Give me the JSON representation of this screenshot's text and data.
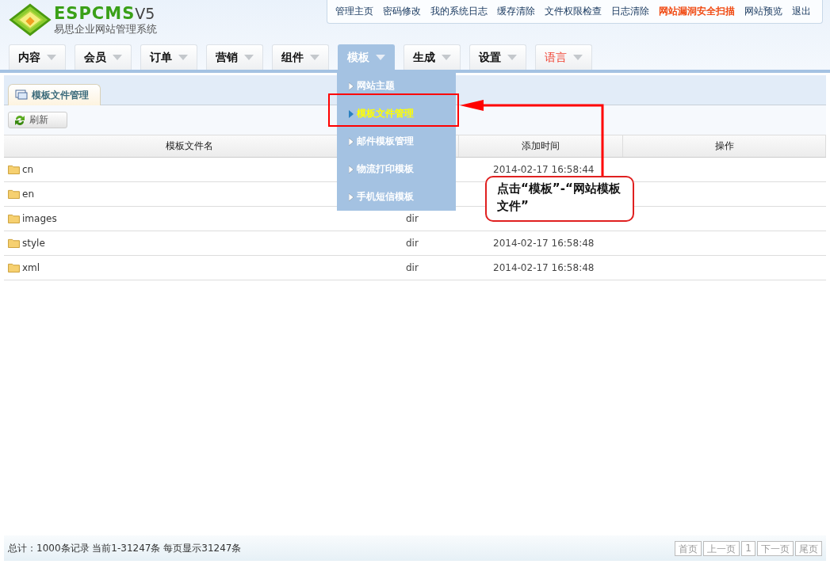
{
  "logo": {
    "brand": "ESPCMS",
    "version": "V5",
    "subtitle": "易思企业网站管理系统"
  },
  "top_links": [
    {
      "label": "管理主页",
      "alert": false
    },
    {
      "label": "密码修改",
      "alert": false
    },
    {
      "label": "我的系统日志",
      "alert": false
    },
    {
      "label": "缓存清除",
      "alert": false
    },
    {
      "label": "文件权限检查",
      "alert": false
    },
    {
      "label": "日志清除",
      "alert": false
    },
    {
      "label": "网站漏洞安全扫描",
      "alert": true
    },
    {
      "label": "网站预览",
      "alert": false
    },
    {
      "label": "退出",
      "alert": false
    }
  ],
  "nav": [
    {
      "label": "内容",
      "selected": false,
      "alert": false
    },
    {
      "label": "会员",
      "selected": false,
      "alert": false
    },
    {
      "label": "订单",
      "selected": false,
      "alert": false
    },
    {
      "label": "营销",
      "selected": false,
      "alert": false
    },
    {
      "label": "组件",
      "selected": false,
      "alert": false
    },
    {
      "label": "模板",
      "selected": true,
      "alert": false
    },
    {
      "label": "生成",
      "selected": false,
      "alert": false
    },
    {
      "label": "设置",
      "selected": false,
      "alert": false
    },
    {
      "label": "语言",
      "selected": false,
      "alert": true
    }
  ],
  "dropdown": [
    {
      "label": "网站主题",
      "selected": false
    },
    {
      "label": "模板文件管理",
      "selected": true
    },
    {
      "label": "邮件模板管理",
      "selected": false
    },
    {
      "label": "物流打印模板",
      "selected": false
    },
    {
      "label": "手机短信模板",
      "selected": false
    }
  ],
  "page_tab": {
    "label": "模板文件管理"
  },
  "toolbar": {
    "refresh": "刷新"
  },
  "table": {
    "columns": [
      "模板文件名",
      "",
      "添加时间",
      "操作"
    ],
    "rows": [
      {
        "name": "cn",
        "type": "",
        "time": "2014-02-17 16:58:44"
      },
      {
        "name": "en",
        "type": "",
        "time": ""
      },
      {
        "name": "images",
        "type": "dir",
        "time": ""
      },
      {
        "name": "style",
        "type": "dir",
        "time": "2014-02-17 16:58:48"
      },
      {
        "name": "xml",
        "type": "dir",
        "time": "2014-02-17 16:58:48"
      }
    ]
  },
  "footer": {
    "summary": "总计：1000条记录 当前1-31247条 每页显示31247条",
    "pages": [
      "首页",
      "上一页",
      "1",
      "下一页",
      "尾页"
    ]
  },
  "callout": {
    "text": "点击“模板”-“网站模板文件”"
  }
}
